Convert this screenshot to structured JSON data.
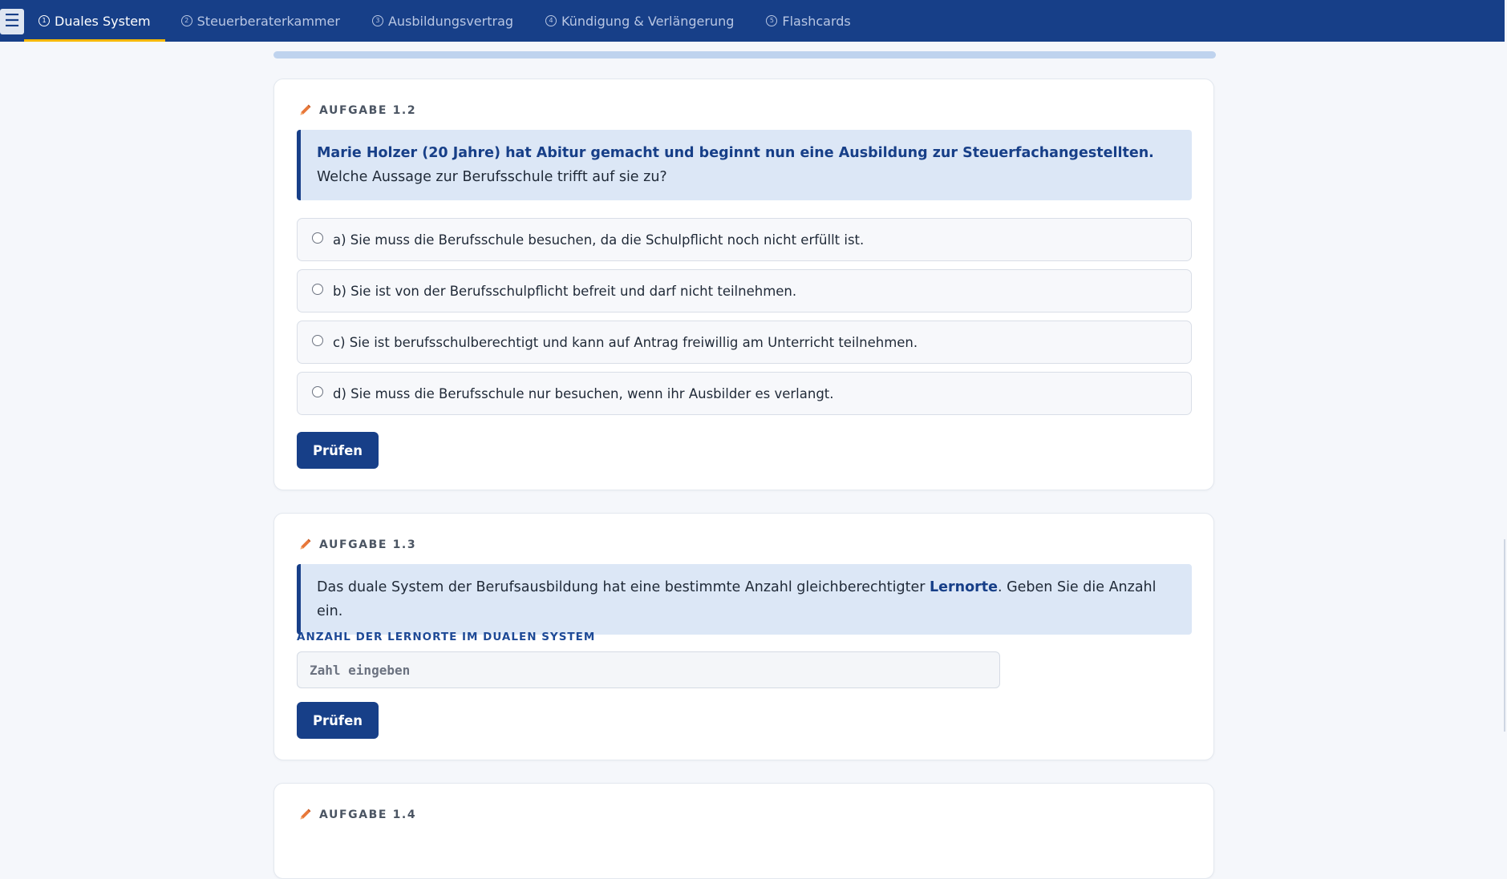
{
  "nav": {
    "tabs": [
      {
        "num": "1",
        "label": "Duales System"
      },
      {
        "num": "2",
        "label": "Steuerberaterkammer"
      },
      {
        "num": "3",
        "label": "Ausbildungsvertrag"
      },
      {
        "num": "4",
        "label": "Kündigung & Verlängerung"
      },
      {
        "num": "5",
        "label": "Flashcards"
      }
    ],
    "active_tab": "Duales System"
  },
  "task_1_2": {
    "label": "AUFGABE 1.2",
    "question_highlight": "Marie Holzer (20 Jahre) hat Abitur gemacht und beginnt nun eine Ausbildung zur Steuerfachangestellten.",
    "question_rest": " Welche Aussage zur Berufsschule trifft auf sie zu?",
    "options": [
      "a) Sie muss die Berufsschule besuchen, da die Schulpflicht noch nicht erfüllt ist.",
      "b) Sie ist von der Berufsschulpflicht befreit und darf nicht teilnehmen.",
      "c) Sie ist berufsschulberechtigt und kann auf Antrag freiwillig am Unterricht teilnehmen.",
      "d) Sie muss die Berufsschule nur besuchen, wenn ihr Ausbilder es verlangt."
    ],
    "button": "Prüfen"
  },
  "task_1_3": {
    "label": "AUFGABE 1.3",
    "question_before": "Das duale System der Berufsausbildung hat eine bestimmte Anzahl gleichberechtigter ",
    "question_keyword": "Lernorte",
    "question_after": ". Geben Sie die Anzahl ein.",
    "field_label": "ANZAHL DER LERNORTE IM DUALEN SYSTEM",
    "input_placeholder": "Zahl eingeben",
    "input_value": "",
    "button": "Prüfen"
  },
  "task_1_4": {
    "label": "AUFGABE 1.4"
  },
  "colors": {
    "nav_bg": "#173f88",
    "active_underline": "#f5b800",
    "accent": "#173f88",
    "question_bg": "#dce7f6",
    "pencil": "#e8783a"
  }
}
